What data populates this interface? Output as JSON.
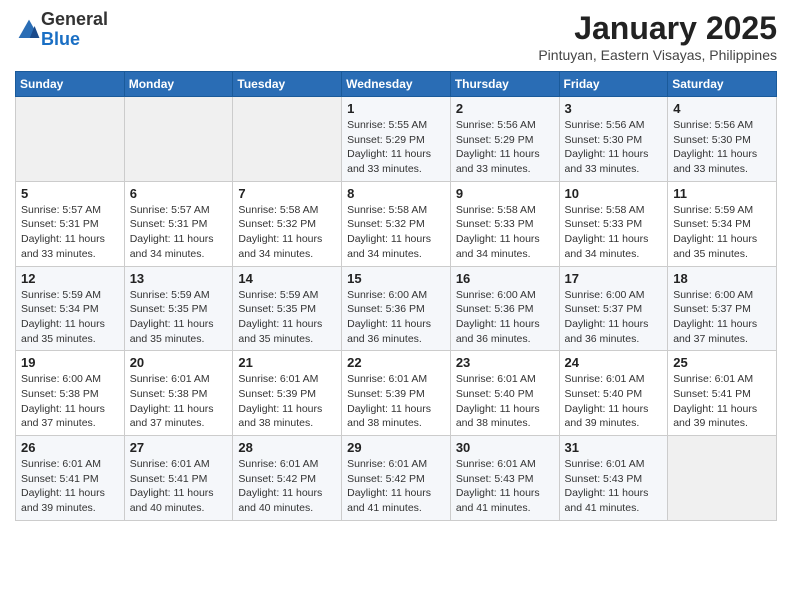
{
  "logo": {
    "general": "General",
    "blue": "Blue"
  },
  "title": "January 2025",
  "location": "Pintuyan, Eastern Visayas, Philippines",
  "headers": [
    "Sunday",
    "Monday",
    "Tuesday",
    "Wednesday",
    "Thursday",
    "Friday",
    "Saturday"
  ],
  "weeks": [
    [
      {
        "day": "",
        "info": ""
      },
      {
        "day": "",
        "info": ""
      },
      {
        "day": "",
        "info": ""
      },
      {
        "day": "1",
        "info": "Sunrise: 5:55 AM\nSunset: 5:29 PM\nDaylight: 11 hours\nand 33 minutes."
      },
      {
        "day": "2",
        "info": "Sunrise: 5:56 AM\nSunset: 5:29 PM\nDaylight: 11 hours\nand 33 minutes."
      },
      {
        "day": "3",
        "info": "Sunrise: 5:56 AM\nSunset: 5:30 PM\nDaylight: 11 hours\nand 33 minutes."
      },
      {
        "day": "4",
        "info": "Sunrise: 5:56 AM\nSunset: 5:30 PM\nDaylight: 11 hours\nand 33 minutes."
      }
    ],
    [
      {
        "day": "5",
        "info": "Sunrise: 5:57 AM\nSunset: 5:31 PM\nDaylight: 11 hours\nand 33 minutes."
      },
      {
        "day": "6",
        "info": "Sunrise: 5:57 AM\nSunset: 5:31 PM\nDaylight: 11 hours\nand 34 minutes."
      },
      {
        "day": "7",
        "info": "Sunrise: 5:58 AM\nSunset: 5:32 PM\nDaylight: 11 hours\nand 34 minutes."
      },
      {
        "day": "8",
        "info": "Sunrise: 5:58 AM\nSunset: 5:32 PM\nDaylight: 11 hours\nand 34 minutes."
      },
      {
        "day": "9",
        "info": "Sunrise: 5:58 AM\nSunset: 5:33 PM\nDaylight: 11 hours\nand 34 minutes."
      },
      {
        "day": "10",
        "info": "Sunrise: 5:58 AM\nSunset: 5:33 PM\nDaylight: 11 hours\nand 34 minutes."
      },
      {
        "day": "11",
        "info": "Sunrise: 5:59 AM\nSunset: 5:34 PM\nDaylight: 11 hours\nand 35 minutes."
      }
    ],
    [
      {
        "day": "12",
        "info": "Sunrise: 5:59 AM\nSunset: 5:34 PM\nDaylight: 11 hours\nand 35 minutes."
      },
      {
        "day": "13",
        "info": "Sunrise: 5:59 AM\nSunset: 5:35 PM\nDaylight: 11 hours\nand 35 minutes."
      },
      {
        "day": "14",
        "info": "Sunrise: 5:59 AM\nSunset: 5:35 PM\nDaylight: 11 hours\nand 35 minutes."
      },
      {
        "day": "15",
        "info": "Sunrise: 6:00 AM\nSunset: 5:36 PM\nDaylight: 11 hours\nand 36 minutes."
      },
      {
        "day": "16",
        "info": "Sunrise: 6:00 AM\nSunset: 5:36 PM\nDaylight: 11 hours\nand 36 minutes."
      },
      {
        "day": "17",
        "info": "Sunrise: 6:00 AM\nSunset: 5:37 PM\nDaylight: 11 hours\nand 36 minutes."
      },
      {
        "day": "18",
        "info": "Sunrise: 6:00 AM\nSunset: 5:37 PM\nDaylight: 11 hours\nand 37 minutes."
      }
    ],
    [
      {
        "day": "19",
        "info": "Sunrise: 6:00 AM\nSunset: 5:38 PM\nDaylight: 11 hours\nand 37 minutes."
      },
      {
        "day": "20",
        "info": "Sunrise: 6:01 AM\nSunset: 5:38 PM\nDaylight: 11 hours\nand 37 minutes."
      },
      {
        "day": "21",
        "info": "Sunrise: 6:01 AM\nSunset: 5:39 PM\nDaylight: 11 hours\nand 38 minutes."
      },
      {
        "day": "22",
        "info": "Sunrise: 6:01 AM\nSunset: 5:39 PM\nDaylight: 11 hours\nand 38 minutes."
      },
      {
        "day": "23",
        "info": "Sunrise: 6:01 AM\nSunset: 5:40 PM\nDaylight: 11 hours\nand 38 minutes."
      },
      {
        "day": "24",
        "info": "Sunrise: 6:01 AM\nSunset: 5:40 PM\nDaylight: 11 hours\nand 39 minutes."
      },
      {
        "day": "25",
        "info": "Sunrise: 6:01 AM\nSunset: 5:41 PM\nDaylight: 11 hours\nand 39 minutes."
      }
    ],
    [
      {
        "day": "26",
        "info": "Sunrise: 6:01 AM\nSunset: 5:41 PM\nDaylight: 11 hours\nand 39 minutes."
      },
      {
        "day": "27",
        "info": "Sunrise: 6:01 AM\nSunset: 5:41 PM\nDaylight: 11 hours\nand 40 minutes."
      },
      {
        "day": "28",
        "info": "Sunrise: 6:01 AM\nSunset: 5:42 PM\nDaylight: 11 hours\nand 40 minutes."
      },
      {
        "day": "29",
        "info": "Sunrise: 6:01 AM\nSunset: 5:42 PM\nDaylight: 11 hours\nand 41 minutes."
      },
      {
        "day": "30",
        "info": "Sunrise: 6:01 AM\nSunset: 5:43 PM\nDaylight: 11 hours\nand 41 minutes."
      },
      {
        "day": "31",
        "info": "Sunrise: 6:01 AM\nSunset: 5:43 PM\nDaylight: 11 hours\nand 41 minutes."
      },
      {
        "day": "",
        "info": ""
      }
    ]
  ]
}
